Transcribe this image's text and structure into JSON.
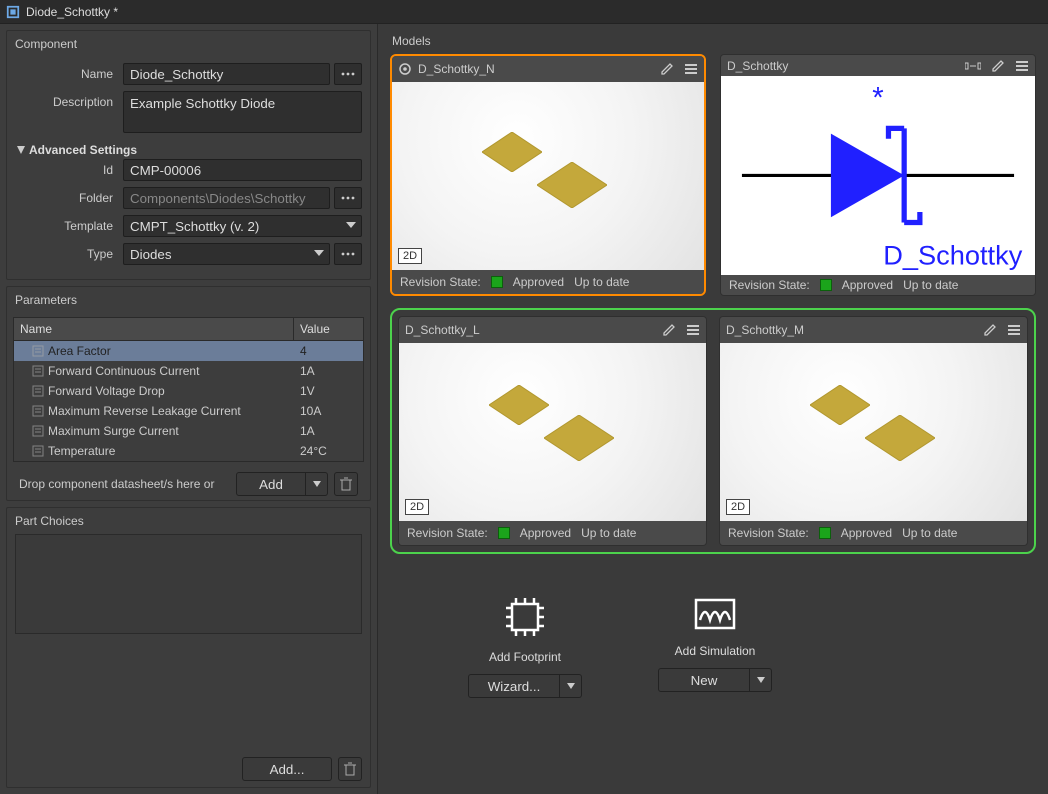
{
  "title": "Diode_Schottky *",
  "left": {
    "component_hdr": "Component",
    "name_label": "Name",
    "name_value": "Diode_Schottky",
    "desc_label": "Description",
    "desc_value": "Example Schottky Diode",
    "adv_hdr": "Advanced Settings",
    "id_label": "Id",
    "id_value": "CMP-00006",
    "folder_label": "Folder",
    "folder_value": "Components\\Diodes\\Schottky",
    "template_label": "Template",
    "template_value": "CMPT_Schottky (v. 2)",
    "type_label": "Type",
    "type_value": "Diodes",
    "params_hdr": "Parameters",
    "params_head_name": "Name",
    "params_head_value": "Value",
    "params": [
      {
        "name": "Area Factor",
        "value": "4",
        "selected": true
      },
      {
        "name": "Forward Continuous Current",
        "value": "1A"
      },
      {
        "name": "Forward Voltage Drop",
        "value": "1V"
      },
      {
        "name": "Maximum Reverse Leakage Current",
        "value": "10A"
      },
      {
        "name": "Maximum Surge Current",
        "value": "1A"
      },
      {
        "name": "Temperature",
        "value": "24°C"
      }
    ],
    "drop_text": "Drop component datasheet/s here or",
    "add_btn": "Add",
    "pc_hdr": "Part Choices",
    "pc_add": "Add..."
  },
  "right": {
    "hdr": "Models",
    "cards": {
      "c1": {
        "title": "D_Schottky_N",
        "rev_label": "Revision State:",
        "approved": "Approved",
        "upd": "Up to date",
        "tag": "2D"
      },
      "c2": {
        "title": "D_Schottky",
        "rev_label": "Revision State:",
        "approved": "Approved",
        "upd": "Up to date",
        "caption": "D_Schottky",
        "star": "*"
      },
      "c3": {
        "title": "D_Schottky_L",
        "rev_label": "Revision State:",
        "approved": "Approved",
        "upd": "Up to date",
        "tag": "2D"
      },
      "c4": {
        "title": "D_Schottky_M",
        "rev_label": "Revision State:",
        "approved": "Approved",
        "upd": "Up to date",
        "tag": "2D"
      }
    },
    "add_fp": "Add Footprint",
    "add_sim": "Add Simulation",
    "wizard": "Wizard...",
    "new": "New"
  }
}
